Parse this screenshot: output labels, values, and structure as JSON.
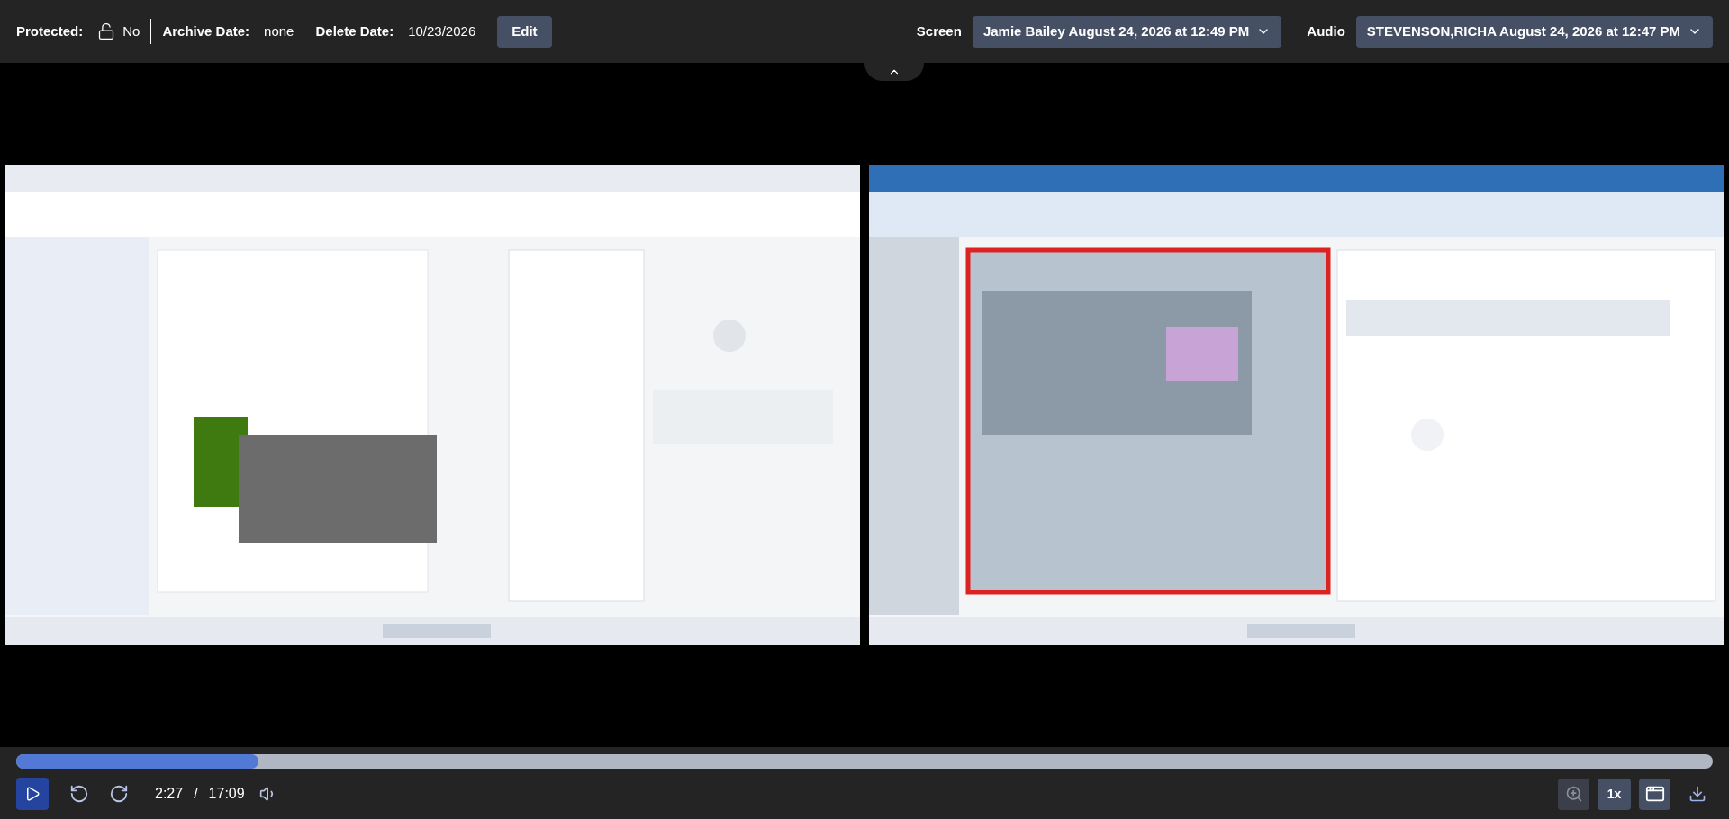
{
  "info_bar": {
    "protected_label": "Protected:",
    "protected": false,
    "protected_value": "No",
    "archive_label": "Archive Date:",
    "archive_value": "none",
    "delete_label": "Delete Date:",
    "delete_value": "10/23/2026",
    "edit_button": "Edit"
  },
  "sources": [
    {
      "label": "Screen",
      "value": "Jamie Bailey August 24, 2026 at 12:49 PM"
    },
    {
      "label": "Audio",
      "value": "STEVENSON,RICHA August 24, 2026 at 12:47 PM"
    }
  ],
  "player": {
    "level": 0.143,
    "current_time": "2:27",
    "separator": "/",
    "duration": "17:09",
    "playing": false,
    "speed": "1x"
  }
}
